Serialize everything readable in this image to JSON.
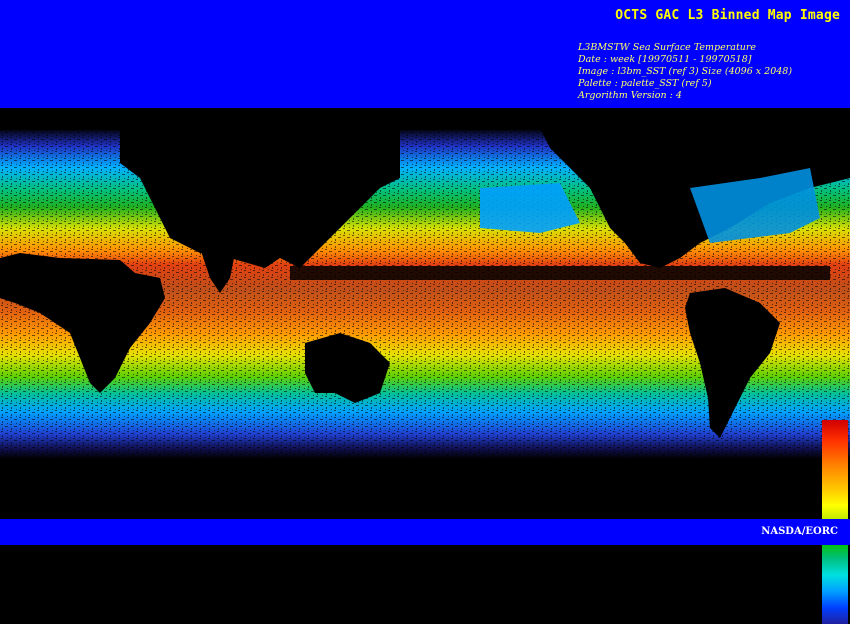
{
  "title": "OCTS GAC L3 Binned Map Image",
  "metadata": [
    "L3BMSTW Sea Surface Temperature",
    "Date : week [19970511 - 19970518]",
    "Image : l3bm_SST (ref 3) Size (4096 x 2048)",
    "Palette : palette_SST (ref 5)",
    "Argorithm Version : 4"
  ],
  "credit": "NASDA/EORC",
  "colors": {
    "banner": "#0000ff",
    "title_text": "#ffff00",
    "meta_text": "#ffff66",
    "land": "#000000"
  },
  "palette_gradient": [
    "#d00000",
    "#ff8000",
    "#ffff00",
    "#00c000",
    "#00e0e0",
    "#0040ff",
    "#2020a0"
  ]
}
